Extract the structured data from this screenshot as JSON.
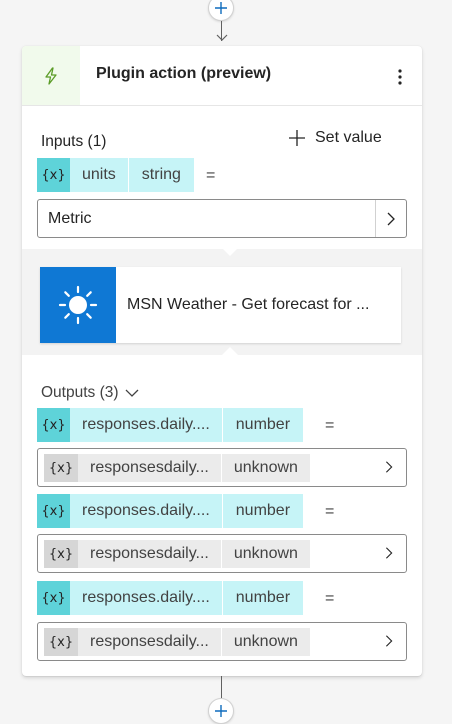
{
  "card": {
    "title": "Plugin action (preview)",
    "more_icon": "more-vertical-icon",
    "header_icon": "lightning-bolt-icon"
  },
  "inputs": {
    "label": "Inputs (1)",
    "set_value_label": "Set value",
    "variable": {
      "icon": "{x}",
      "name": "units",
      "type": "string",
      "eq": "="
    },
    "value": "Metric"
  },
  "connector": {
    "name": "MSN Weather - Get forecast for ...",
    "icon": "sun-icon"
  },
  "outputs": {
    "label": "Outputs (3)",
    "items": [
      {
        "icon": "{x}",
        "name": "responses.daily....",
        "type": "number",
        "eq": "=",
        "target": {
          "icon": "{x}",
          "name": "responsesdaily...",
          "type": "unknown"
        }
      },
      {
        "icon": "{x}",
        "name": "responses.daily....",
        "type": "number",
        "eq": "=",
        "target": {
          "icon": "{x}",
          "name": "responsesdaily...",
          "type": "unknown"
        }
      },
      {
        "icon": "{x}",
        "name": "responses.daily....",
        "type": "number",
        "eq": "=",
        "target": {
          "icon": "{x}",
          "name": "responsesdaily...",
          "type": "unknown"
        }
      }
    ]
  },
  "colors": {
    "variable_chip": "#c6f4f7",
    "variable_chip_icon": "#5ed3d9",
    "connector_logo": "#0f78d4",
    "header_icon_bg": "#f1faec"
  }
}
